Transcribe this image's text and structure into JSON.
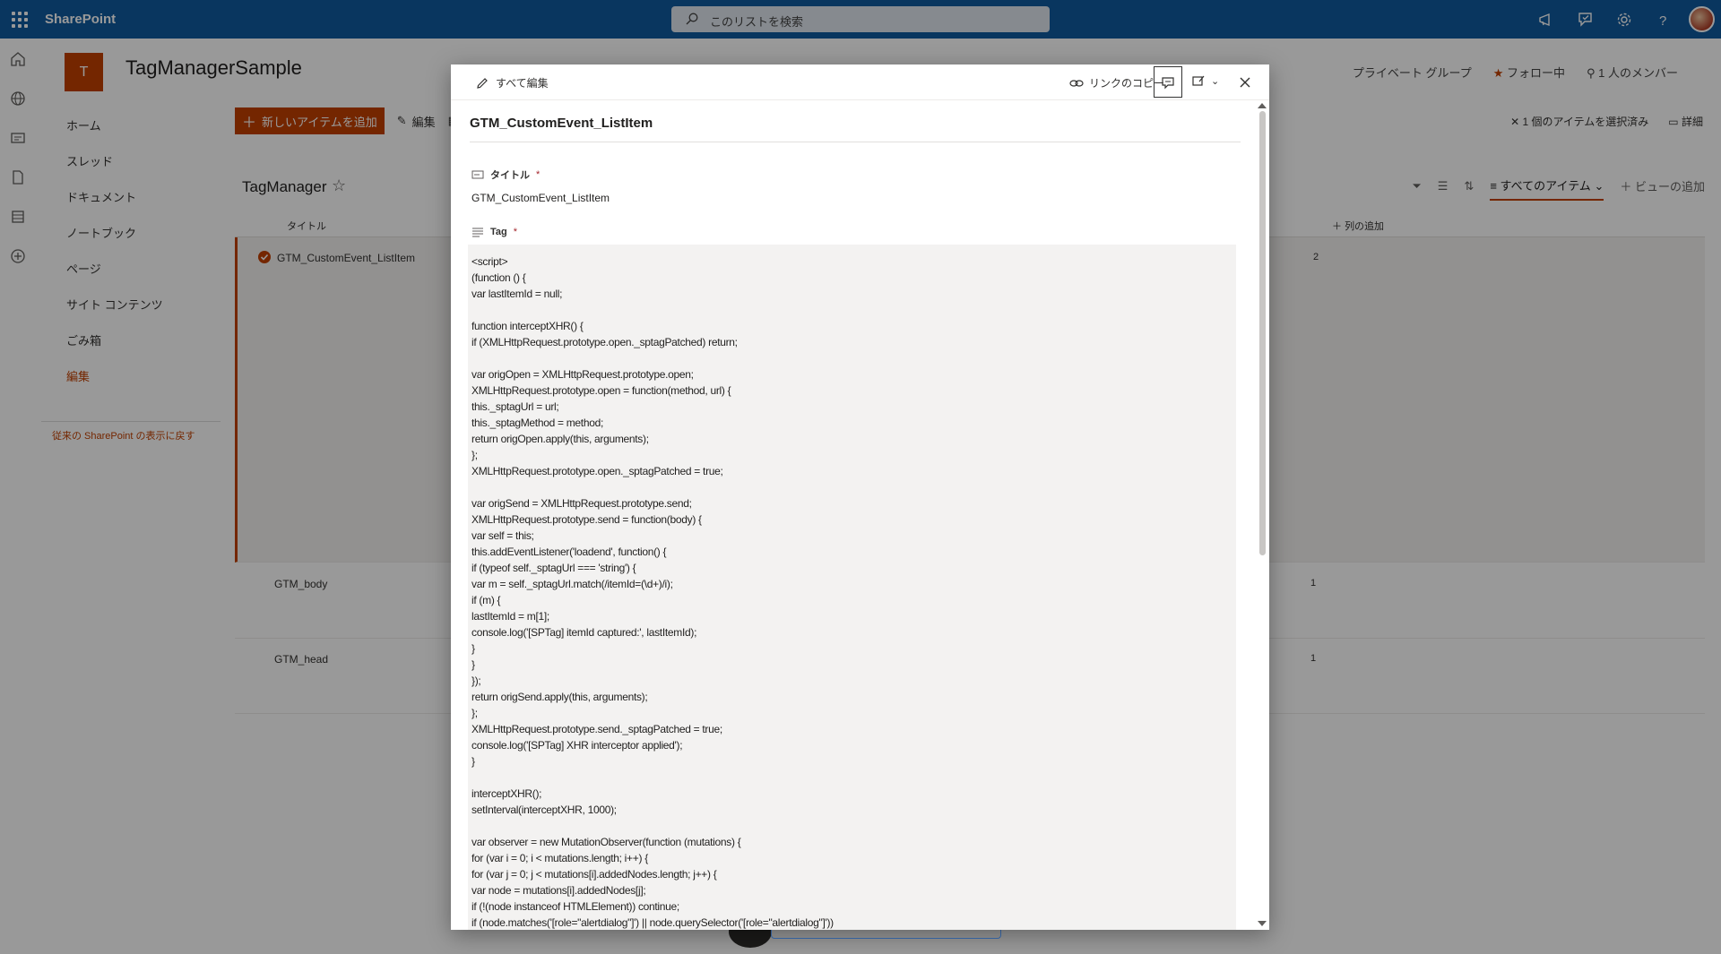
{
  "topbar": {
    "brand": "SharePoint",
    "search_placeholder": "このリストを検索"
  },
  "site": {
    "logo_letter": "T",
    "title": "TagManagerSample",
    "group_type": "プライベート グループ",
    "follow_label": "フォロー中",
    "members_label": "1 人のメンバー"
  },
  "nav": {
    "items": [
      {
        "label": "ホーム"
      },
      {
        "label": "スレッド"
      },
      {
        "label": "ドキュメント"
      },
      {
        "label": "ノートブック"
      },
      {
        "label": "ページ"
      },
      {
        "label": "サイト コンテンツ"
      },
      {
        "label": "ごみ箱"
      },
      {
        "label": "編集"
      }
    ],
    "classic_link": "従来の SharePoint の表示に戻す"
  },
  "commandbar": {
    "new_item": "新しいアイテムを追加",
    "edit": "編集",
    "selected": "1 個のアイテムを選択済み",
    "details": "詳細"
  },
  "list": {
    "title": "TagManager",
    "view_name": "すべてのアイテム",
    "add_view": "ビューの追加",
    "col_title": "タイトル",
    "add_column": "列の追加",
    "rows": [
      {
        "title": "GTM_CustomEvent_ListItem",
        "num": "2"
      },
      {
        "title": "GTM_body",
        "num": "1"
      },
      {
        "title": "GTM_head",
        "num": "1"
      }
    ]
  },
  "panel": {
    "edit_all": "すべて編集",
    "copy_link": "リンクのコピー",
    "item_title": "GTM_CustomEvent_ListItem",
    "field_title_label": "タイトル",
    "field_title_value": "GTM_CustomEvent_ListItem",
    "field_tag_label": "Tag",
    "required_mark": "*",
    "tag_value": "<script>\n(function () {\nvar lastItemId = null;\n\nfunction interceptXHR() {\nif (XMLHttpRequest.prototype.open._sptagPatched) return;\n\nvar origOpen = XMLHttpRequest.prototype.open;\nXMLHttpRequest.prototype.open = function(method, url) {\nthis._sptagUrl = url;\nthis._sptagMethod = method;\nreturn origOpen.apply(this, arguments);\n};\nXMLHttpRequest.prototype.open._sptagPatched = true;\n\nvar origSend = XMLHttpRequest.prototype.send;\nXMLHttpRequest.prototype.send = function(body) {\nvar self = this;\nthis.addEventListener('loadend', function() {\nif (typeof self._sptagUrl === 'string') {\nvar m = self._sptagUrl.match(/itemId=(\\d+)/i);\nif (m) {\nlastItemId = m[1];\nconsole.log('[SPTag] itemId captured:', lastItemId);\n}\n}\n});\nreturn origSend.apply(this, arguments);\n};\nXMLHttpRequest.prototype.send._sptagPatched = true;\nconsole.log('[SPTag] XHR interceptor applied');\n}\n\ninterceptXHR();\nsetInterval(interceptXHR, 1000);\n\nvar observer = new MutationObserver(function (mutations) {\nfor (var i = 0; i < mutations.length; i++) {\nfor (var j = 0; j < mutations[i].addedNodes.length; j++) {\nvar node = mutations[i].addedNodes[j];\nif (!(node instanceof HTMLElement)) continue;\nif (node.matches('[role=\"alertdialog\"]') || node.querySelector('[role=\"alertdialog\"]'))"
  },
  "colors": {
    "suite_bar": "#0f5a9e",
    "accent": "#c24000",
    "overlay": "rgba(0,0,0,0.4)"
  }
}
